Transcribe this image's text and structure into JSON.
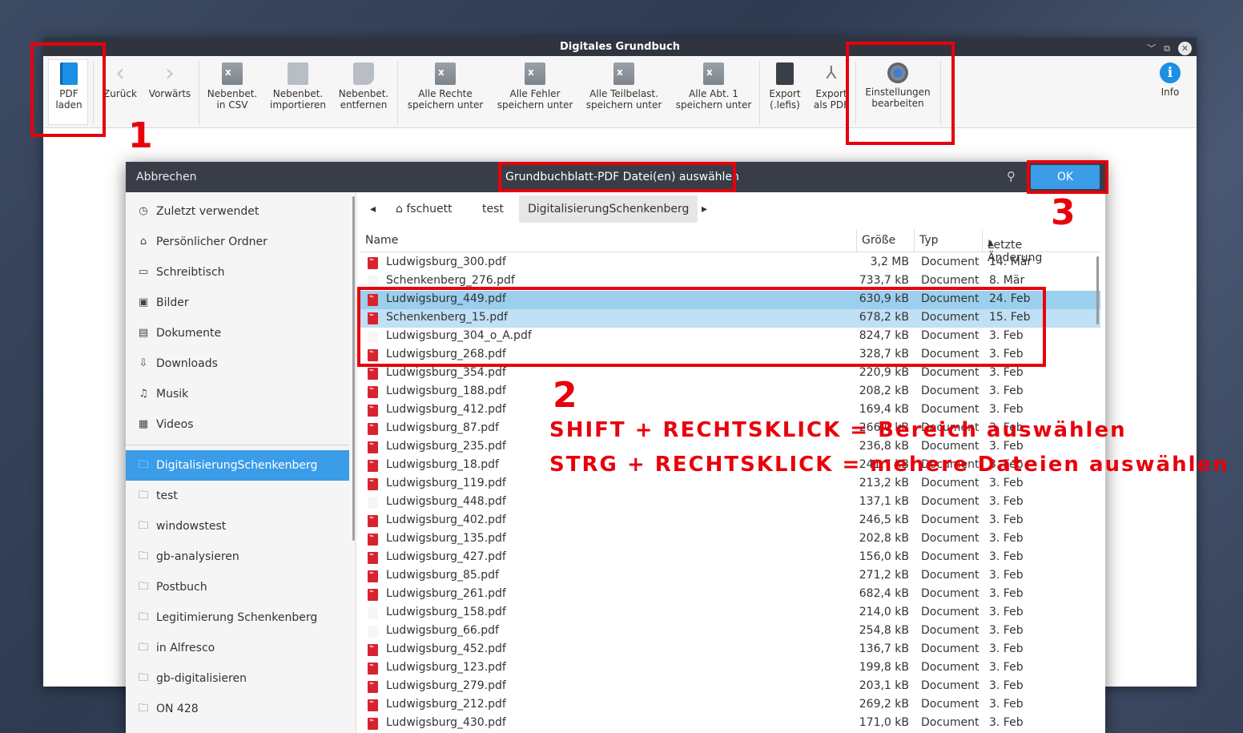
{
  "window": {
    "title": "Digitales Grundbuch"
  },
  "toolbar": {
    "items": [
      {
        "label": "PDF\nladen",
        "icon": "book-icon"
      },
      {
        "label": "Zurück",
        "icon": "chevron-left-icon"
      },
      {
        "label": "Vorwärts",
        "icon": "chevron-right-icon"
      },
      {
        "label": "Nebenbet.\nin CSV",
        "icon": "spreadsheet-icon"
      },
      {
        "label": "Nebenbet.\nimportieren",
        "icon": "import-icon"
      },
      {
        "label": "Nebenbet.\nentfernen",
        "icon": "remove-icon"
      },
      {
        "label": "Alle Rechte\nspeichern unter",
        "icon": "spreadsheet-icon"
      },
      {
        "label": "Alle Fehler\nspeichern unter",
        "icon": "spreadsheet-icon"
      },
      {
        "label": "Alle Teilbelast.\nspeichern unter",
        "icon": "spreadsheet-icon"
      },
      {
        "label": "Alle Abt. 1\nspeichern unter",
        "icon": "spreadsheet-icon"
      },
      {
        "label": "Export\n(.lefis)",
        "icon": "export-icon"
      },
      {
        "label": "Export\nals PDF",
        "icon": "pdf-export-icon"
      },
      {
        "label": "Einstellungen\nbearbeiten",
        "icon": "gear-icon"
      },
      {
        "label": "Info",
        "icon": "info-icon"
      }
    ]
  },
  "dialog": {
    "cancel": "Abbrechen",
    "title": "Grundbuchblatt-PDF Datei(en) auswählen",
    "ok": "OK",
    "sidebar": {
      "places": [
        {
          "label": "Zuletzt verwendet",
          "icon": "clock-icon"
        },
        {
          "label": "Persönlicher Ordner",
          "icon": "home-icon"
        },
        {
          "label": "Schreibtisch",
          "icon": "desktop-icon"
        },
        {
          "label": "Bilder",
          "icon": "image-icon"
        },
        {
          "label": "Dokumente",
          "icon": "document-icon"
        },
        {
          "label": "Downloads",
          "icon": "download-icon"
        },
        {
          "label": "Musik",
          "icon": "music-icon"
        },
        {
          "label": "Videos",
          "icon": "video-icon"
        }
      ],
      "bookmarks": [
        {
          "label": "DigitalisierungSchenkenberg",
          "active": true
        },
        {
          "label": "test"
        },
        {
          "label": "windowstest"
        },
        {
          "label": "gb-analysieren"
        },
        {
          "label": "Postbuch"
        },
        {
          "label": "Legitimierung Schenkenberg"
        },
        {
          "label": "in Alfresco"
        },
        {
          "label": "gb-digitalisieren"
        },
        {
          "label": "ON 428"
        }
      ]
    },
    "path": {
      "home": "fschuett",
      "mid": "test",
      "current": "DigitalisierungSchenkenberg"
    },
    "columns": {
      "name": "Name",
      "size": "Größe",
      "type": "Typ",
      "date": "Letzte Änderung"
    },
    "files": [
      {
        "name": "Ludwigsburg_300.pdf",
        "size": "3,2 MB",
        "type": "Document",
        "date": "14. Mär",
        "icon": "pdf"
      },
      {
        "name": "Schenkenberg_276.pdf",
        "size": "733,7 kB",
        "type": "Document",
        "date": "8. Mär",
        "icon": "blank"
      },
      {
        "name": "Ludwigsburg_449.pdf",
        "size": "630,9 kB",
        "type": "Document",
        "date": "24. Feb",
        "icon": "pdf",
        "sel": 1
      },
      {
        "name": "Schenkenberg_15.pdf",
        "size": "678,2 kB",
        "type": "Document",
        "date": "15. Feb",
        "icon": "pdf",
        "sel": 2
      },
      {
        "name": "Ludwigsburg_304_o_A.pdf",
        "size": "824,7 kB",
        "type": "Document",
        "date": "3. Feb",
        "icon": "blank"
      },
      {
        "name": "Ludwigsburg_268.pdf",
        "size": "328,7 kB",
        "type": "Document",
        "date": "3. Feb",
        "icon": "pdf"
      },
      {
        "name": "Ludwigsburg_354.pdf",
        "size": "220,9 kB",
        "type": "Document",
        "date": "3. Feb",
        "icon": "pdf"
      },
      {
        "name": "Ludwigsburg_188.pdf",
        "size": "208,2 kB",
        "type": "Document",
        "date": "3. Feb",
        "icon": "pdf"
      },
      {
        "name": "Ludwigsburg_412.pdf",
        "size": "169,4 kB",
        "type": "Document",
        "date": "3. Feb",
        "icon": "pdf"
      },
      {
        "name": "Ludwigsburg_87.pdf",
        "size": "266,0 kB",
        "type": "Document",
        "date": "3. Feb",
        "icon": "pdf"
      },
      {
        "name": "Ludwigsburg_235.pdf",
        "size": "236,8 kB",
        "type": "Document",
        "date": "3. Feb",
        "icon": "pdf"
      },
      {
        "name": "Ludwigsburg_18.pdf",
        "size": "241,7 kB",
        "type": "Document",
        "date": "3. Feb",
        "icon": "pdf"
      },
      {
        "name": "Ludwigsburg_119.pdf",
        "size": "213,2 kB",
        "type": "Document",
        "date": "3. Feb",
        "icon": "pdf"
      },
      {
        "name": "Ludwigsburg_448.pdf",
        "size": "137,1 kB",
        "type": "Document",
        "date": "3. Feb",
        "icon": "blank"
      },
      {
        "name": "Ludwigsburg_402.pdf",
        "size": "246,5 kB",
        "type": "Document",
        "date": "3. Feb",
        "icon": "pdf"
      },
      {
        "name": "Ludwigsburg_135.pdf",
        "size": "202,8 kB",
        "type": "Document",
        "date": "3. Feb",
        "icon": "pdf"
      },
      {
        "name": "Ludwigsburg_427.pdf",
        "size": "156,0 kB",
        "type": "Document",
        "date": "3. Feb",
        "icon": "pdf"
      },
      {
        "name": "Ludwigsburg_85.pdf",
        "size": "271,2 kB",
        "type": "Document",
        "date": "3. Feb",
        "icon": "pdf"
      },
      {
        "name": "Ludwigsburg_261.pdf",
        "size": "682,4 kB",
        "type": "Document",
        "date": "3. Feb",
        "icon": "pdf"
      },
      {
        "name": "Ludwigsburg_158.pdf",
        "size": "214,0 kB",
        "type": "Document",
        "date": "3. Feb",
        "icon": "blank"
      },
      {
        "name": "Ludwigsburg_66.pdf",
        "size": "254,8 kB",
        "type": "Document",
        "date": "3. Feb",
        "icon": "blank"
      },
      {
        "name": "Ludwigsburg_452.pdf",
        "size": "136,7 kB",
        "type": "Document",
        "date": "3. Feb",
        "icon": "pdf"
      },
      {
        "name": "Ludwigsburg_123.pdf",
        "size": "199,8 kB",
        "type": "Document",
        "date": "3. Feb",
        "icon": "pdf"
      },
      {
        "name": "Ludwigsburg_279.pdf",
        "size": "203,1 kB",
        "type": "Document",
        "date": "3. Feb",
        "icon": "pdf"
      },
      {
        "name": "Ludwigsburg_212.pdf",
        "size": "269,2 kB",
        "type": "Document",
        "date": "3. Feb",
        "icon": "pdf"
      },
      {
        "name": "Ludwigsburg_430.pdf",
        "size": "171,0 kB",
        "type": "Document",
        "date": "3. Feb",
        "icon": "pdf"
      }
    ]
  },
  "annotations": {
    "step1": "1",
    "step2": "2",
    "step3": "3",
    "hint1": "SHIFT + RECHTSKLICK = Bereich auswählen",
    "hint2": "STRG + RECHTSKLICK = mehere Dateien auswählen",
    "color": "#e8000b"
  }
}
